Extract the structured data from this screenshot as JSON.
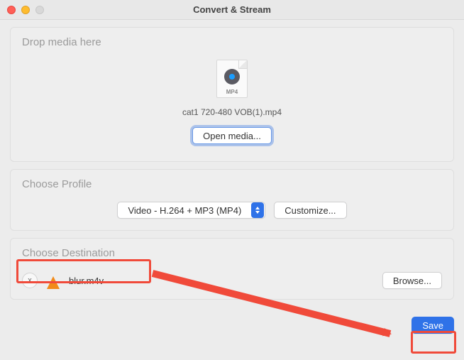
{
  "window": {
    "title": "Convert & Stream"
  },
  "drop": {
    "title": "Drop media here",
    "file_icon_ext": "MP4",
    "filename": "cat1 720-480 VOB(1).mp4",
    "open_button": "Open media..."
  },
  "profile": {
    "title": "Choose Profile",
    "selected": "Video - H.264 + MP3 (MP4)",
    "customize_button": "Customize..."
  },
  "destination": {
    "title": "Choose Destination",
    "clear_label": "x",
    "filename": "blur.m4v",
    "browse_button": "Browse..."
  },
  "footer": {
    "save_button": "Save"
  }
}
